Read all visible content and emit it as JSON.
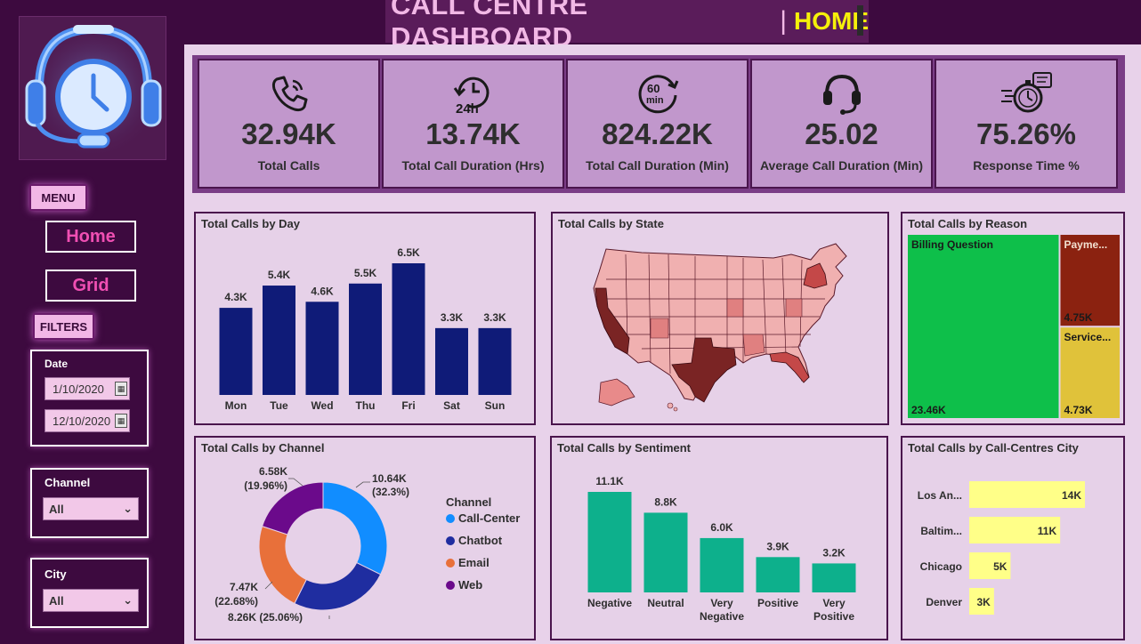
{
  "header": {
    "title": "CALL CENTRE DASHBOARD",
    "separator": "|",
    "page": "HOME"
  },
  "sidebar": {
    "menu_label": "MENU",
    "nav": [
      {
        "label": "Home"
      },
      {
        "label": "Grid"
      }
    ],
    "filters_label": "FILTERS",
    "date": {
      "label": "Date",
      "start": "1/10/2020",
      "end": "12/10/2020"
    },
    "channel": {
      "label": "Channel",
      "value": "All"
    },
    "city": {
      "label": "City",
      "value": "All"
    }
  },
  "kpis": [
    {
      "value": "32.94K",
      "label": "Total Calls",
      "icon": "phone-icon"
    },
    {
      "value": "13.74K",
      "label": "Total Call Duration (Hrs)",
      "icon": "24h-icon"
    },
    {
      "value": "824.22K",
      "label": "Total Call Duration (Min)",
      "icon": "60min-icon"
    },
    {
      "value": "25.02",
      "label": "Average Call Duration (Min)",
      "icon": "headset-icon"
    },
    {
      "value": "75.26%",
      "label": "Response Time %",
      "icon": "stopwatch-icon"
    }
  ],
  "colors": {
    "bar_day": "#0f1b78",
    "bar_sentiment": "#0db08c",
    "bar_city": "#ffff88",
    "treemap_billing": "#0ebf4a",
    "treemap_payments": "#8b2210",
    "treemap_service": "#e0c23a",
    "map_high": "#7a2424",
    "map_mid": "#e07f7f",
    "map_low": "#f2b2b2"
  },
  "chart_data": [
    {
      "type": "bar",
      "title": "Total Calls by Day",
      "categories": [
        "Mon",
        "Tue",
        "Wed",
        "Thu",
        "Fri",
        "Sat",
        "Sun"
      ],
      "values": [
        4.3,
        5.4,
        4.6,
        5.5,
        6.5,
        3.3,
        3.3
      ],
      "labels": [
        "4.3K",
        "5.4K",
        "4.6K",
        "5.5K",
        "6.5K",
        "3.3K",
        "3.3K"
      ]
    },
    {
      "type": "map",
      "title": "Total Calls by State"
    },
    {
      "type": "treemap",
      "title": "Total Calls by Reason",
      "items": [
        {
          "name": "Billing Question",
          "value": 23.46,
          "label": "23.46K"
        },
        {
          "name": "Payme...",
          "value": 4.75,
          "label": "4.75K"
        },
        {
          "name": "Service...",
          "value": 4.73,
          "label": "4.73K"
        }
      ]
    },
    {
      "type": "pie",
      "title": "Total Calls by Channel",
      "legend_title": "Channel",
      "slices": [
        {
          "name": "Call-Center",
          "value": 10.64,
          "label": "10.64K",
          "pct": "(32.3%)",
          "color": "#118dff"
        },
        {
          "name": "Chatbot",
          "value": 8.26,
          "label": "8.26K (25.06%)",
          "color": "#1f2da0"
        },
        {
          "name": "Email",
          "value": 7.47,
          "label": "7.47K",
          "pct": "(22.68%)",
          "color": "#e8703a"
        },
        {
          "name": "Web",
          "value": 6.58,
          "label": "6.58K",
          "pct": "(19.96%)",
          "color": "#6b0a8b"
        }
      ]
    },
    {
      "type": "bar",
      "title": "Total Calls by Sentiment",
      "categories": [
        "Negative",
        "Neutral",
        "Very Negative",
        "Positive",
        "Very Positive"
      ],
      "values": [
        11.1,
        8.8,
        6.0,
        3.9,
        3.2
      ],
      "labels": [
        "11.1K",
        "8.8K",
        "6.0K",
        "3.9K",
        "3.2K"
      ]
    },
    {
      "type": "bar",
      "orientation": "horizontal",
      "title": "Total Calls by Call-Centres City",
      "categories": [
        "Los An...",
        "Baltim...",
        "Chicago",
        "Denver"
      ],
      "values": [
        14,
        11,
        5,
        3
      ],
      "labels": [
        "14K",
        "11K",
        "5K",
        "3K"
      ]
    }
  ]
}
